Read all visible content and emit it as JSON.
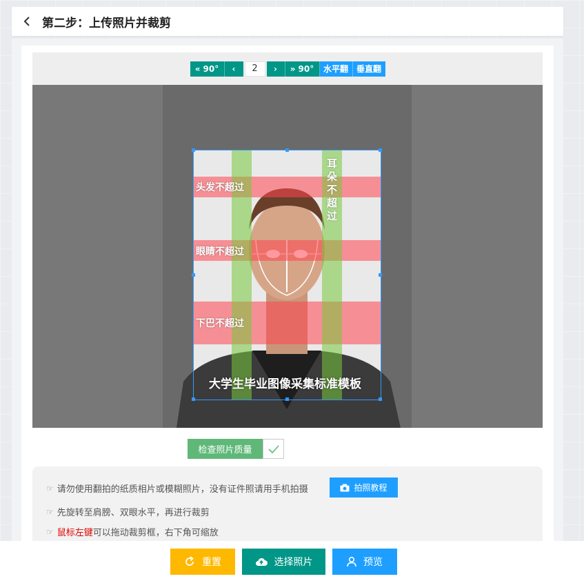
{
  "header": {
    "title": "第二步：上传照片并裁剪"
  },
  "toolbar": {
    "rotate_left_label": "90°",
    "rotate_right_label": "90°",
    "page_number": "2",
    "flip_h_label": "水平翻",
    "flip_v_label": "垂直翻"
  },
  "overlay": {
    "hair_label": "头发不超过",
    "ears_label": "耳朵不超过",
    "eyes_label": "眼睛不超过",
    "chin_label": "下巴不超过",
    "template_caption": "大学生毕业图像采集标准模板"
  },
  "quality_check": {
    "label": "检查照片质量"
  },
  "tips": {
    "tip1": "请勿使用翻拍的纸质相片或模糊照片，没有证件照请用手机拍摄",
    "tutorial_label": "拍照教程",
    "tip2": "先旋转至肩膀、双眼水平，再进行裁剪",
    "tip3_highlight": "鼠标左键",
    "tip3_rest": "可以拖动裁剪框，右下角可缩放"
  },
  "actions": {
    "reset_label": "重置",
    "choose_label": "选择照片",
    "preview_label": "预览"
  },
  "colors": {
    "teal": "#009688",
    "blue": "#1e9fff",
    "green": "#5fb878",
    "yellow": "#ffb800",
    "red_band": "rgba(255,70,80,0.55)",
    "green_band": "rgba(120,200,60,0.55)"
  }
}
